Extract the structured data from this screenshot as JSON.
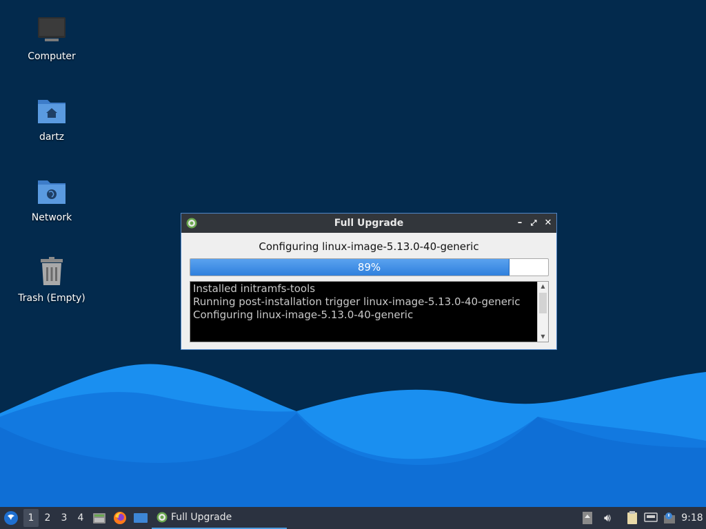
{
  "desktop": {
    "icons": [
      {
        "label": "Computer",
        "icon": "computer-icon"
      },
      {
        "label": "dartz",
        "icon": "home-folder-icon"
      },
      {
        "label": "Network",
        "icon": "network-folder-icon"
      },
      {
        "label": "Trash (Empty)",
        "icon": "trash-icon"
      }
    ]
  },
  "window": {
    "title": "Full Upgrade",
    "status": "Configuring linux-image-5.13.0-40-generic",
    "progress": {
      "value": 89,
      "label": "89%"
    },
    "log_lines": [
      "Installed initramfs-tools",
      "Running post-installation trigger linux-image-5.13.0-40-generic",
      "Configuring linux-image-5.13.0-40-generic"
    ],
    "buttons": {
      "minimize": "minimize-icon",
      "maximize": "maximize-icon",
      "close": "close-icon"
    }
  },
  "taskbar": {
    "workspaces": [
      "1",
      "2",
      "3",
      "4"
    ],
    "active_workspace": "1",
    "launchers": [
      "file-manager-icon",
      "firefox-icon",
      "show-desktop-icon"
    ],
    "task_label": "Full Upgrade",
    "clock": "9:18",
    "tray": [
      "update-icon",
      "volume-icon",
      "clipboard-icon",
      "network-icon",
      "notification-icon"
    ]
  },
  "colors": {
    "accent": "#2f80dd",
    "panel": "#2b3240",
    "desktop": "#032a4d",
    "titlebar": "#32363b"
  }
}
